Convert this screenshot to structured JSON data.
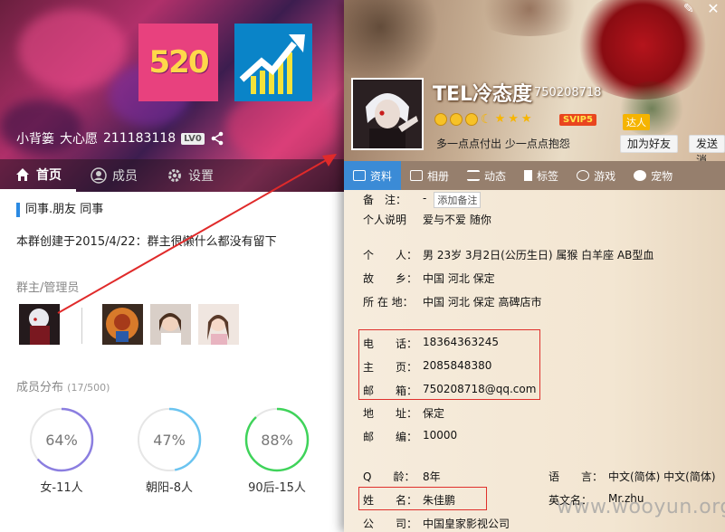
{
  "group": {
    "name": "小背篓",
    "owner_label": "大心愿",
    "number": "211183118",
    "level": "LV0",
    "tabs": [
      {
        "label": "首页",
        "icon": "home-icon"
      },
      {
        "label": "成员",
        "icon": "member-icon"
      },
      {
        "label": "设置",
        "icon": "gear-icon"
      }
    ],
    "tags": "同事.朋友  同事",
    "description": "本群创建于2015/4/22：群主很懒什么都没有留下",
    "admins_title": "群主/管理员",
    "dist_title": "成员分布",
    "dist_count": "(17/500)",
    "distribution": [
      {
        "percent_text": "64%",
        "fraction": 0.64,
        "label": "女-11人",
        "color": "#8b7ee0"
      },
      {
        "percent_text": "47%",
        "fraction": 0.47,
        "label": "朝阳-8人",
        "color": "#6bc4f0"
      },
      {
        "percent_text": "88%",
        "fraction": 0.88,
        "label": "90后-15人",
        "color": "#3fd35a"
      }
    ]
  },
  "profile": {
    "nickname": "TEL冷态度",
    "qq": "750208718",
    "svip": "SVIP5",
    "daren": "达人",
    "signature": "多一点点付出 少一点点抱怨",
    "add_friend": "加为好友",
    "send_msg": "发送消",
    "tabs": [
      {
        "label": "资料",
        "icon": "profile-card-icon"
      },
      {
        "label": "相册",
        "icon": "photo-icon"
      },
      {
        "label": "动态",
        "icon": "list-icon"
      },
      {
        "label": "标签",
        "icon": "bookmark-icon"
      },
      {
        "label": "游戏",
        "icon": "game-icon"
      },
      {
        "label": "宠物",
        "icon": "pet-icon"
      }
    ],
    "remark": {
      "k": "备　注：",
      "v": "-",
      "btn": "添加备注"
    },
    "personal_desc": {
      "k": "个人说明",
      "v": "爱与不爱  随你"
    },
    "person": {
      "k": "个　　人：",
      "v": "男   23岁   3月2日(公历生日)   属猴   白羊座   AB型血"
    },
    "hometown": {
      "k": "故　　乡：",
      "v": "中国  河北  保定"
    },
    "location": {
      "k": "所 在 地：",
      "v": "中国  河北  保定  高碑店市"
    },
    "phone": {
      "k": "电　　话：",
      "v": "18364363245"
    },
    "homepage": {
      "k": "主　　页：",
      "v": "2085848380"
    },
    "email": {
      "k": "邮　　箱：",
      "v": "750208718@qq.com"
    },
    "address": {
      "k": "地　　址：",
      "v": "保定"
    },
    "zip": {
      "k": "邮　　编：",
      "v": "10000"
    },
    "qage": {
      "k": "Q　　龄：",
      "v": "8年"
    },
    "language": {
      "k": "语　　言：",
      "v": "中文(简体)   中文(简体)"
    },
    "realname": {
      "k": "姓　　名：",
      "v": "朱佳鹏"
    },
    "english_name": {
      "k": "英文名：",
      "v": "Mr.zhu"
    },
    "company": {
      "k": "公　　司：",
      "v": "中国皇家影视公司"
    }
  },
  "watermark": "www.wooyun.org"
}
